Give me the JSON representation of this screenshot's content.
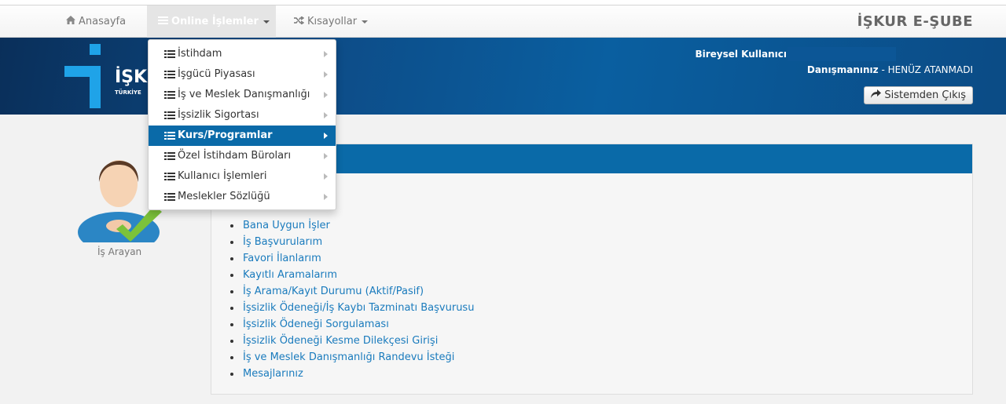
{
  "navbar": {
    "home_label": "Anasayfa",
    "online_label": "Online İşlemler",
    "shortcuts_label": "Kısayollar",
    "brand": "İŞKUR E-ŞUBE"
  },
  "header": {
    "logo_text": "İŞK",
    "logo_sub": "TÜRKİYE",
    "user_label": "Bireysel Kullanıcı",
    "advisor_label": "Danışmanınız",
    "advisor_value": " - HENÜZ ATANMADI",
    "logout_label": "Sistemden Çıkış"
  },
  "dropdown": {
    "items": [
      {
        "label": "İstihdam"
      },
      {
        "label": "İşgücü Piyasası"
      },
      {
        "label": "İş ve Meslek Danışmanlığı"
      },
      {
        "label": "İşsizlik Sigortası"
      },
      {
        "label": "Kurs/Programlar"
      },
      {
        "label": "Özel İstihdam Büroları"
      },
      {
        "label": "Kullanıcı İşlemleri"
      },
      {
        "label": "Meslekler Sözlüğü"
      }
    ],
    "highlighted_index": 4
  },
  "profile": {
    "label": "İş Arayan"
  },
  "links": [
    "Bana Uygun İşler",
    "İş Başvurularım",
    "Favori İlanlarım",
    "Kayıtlı Aramalarım",
    "İş Arama/Kayıt Durumu (Aktif/Pasif)",
    "İşsizlik Ödeneği/İş Kaybı Tazminatı Başvurusu",
    "İşsizlik Ödeneği Sorgulaması",
    "İşsizlik Ödeneği Kesme Dilekçesi Girişi",
    "İş ve Meslek Danışmanlığı Randevu İsteği",
    "Mesajlarınız"
  ],
  "colors": {
    "accent": "#0a6aa8",
    "link": "#1a7bbd",
    "header_dark": "#0a2f5a"
  },
  "icons": {
    "home": "home-icon",
    "list": "list-icon",
    "shuffle": "shuffle-icon",
    "logout": "share-arrow-icon",
    "submenu": "chevron-right-icon"
  }
}
